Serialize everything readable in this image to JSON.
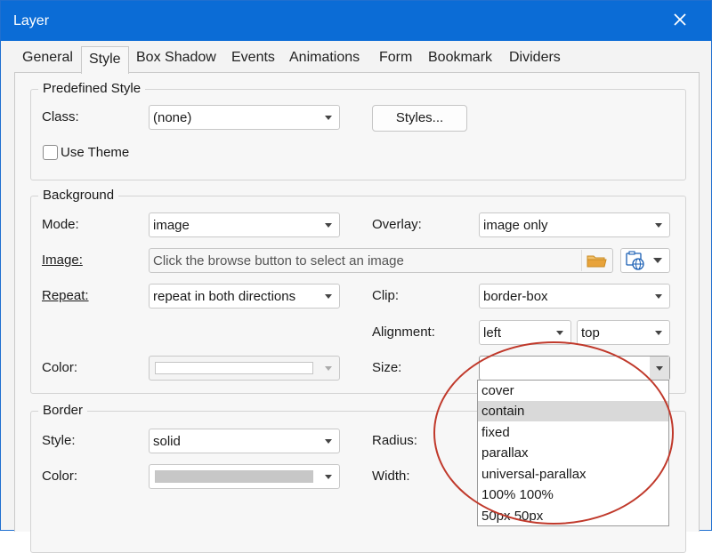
{
  "window": {
    "title": "Layer"
  },
  "tabs": [
    "General",
    "Style",
    "Box Shadow",
    "Events",
    "Animations",
    "Form",
    "Bookmark",
    "Dividers"
  ],
  "predefined": {
    "legend": "Predefined Style",
    "class_label": "Class:",
    "class_value": "(none)",
    "styles_button": "Styles...",
    "use_theme_label": "Use Theme"
  },
  "background": {
    "legend": "Background",
    "mode_label": "Mode:",
    "mode_value": "image",
    "overlay_label": "Overlay:",
    "overlay_value": "image only",
    "image_label": "Image:",
    "image_placeholder": "Click the browse button to select an image",
    "repeat_label": "Repeat:",
    "repeat_value": "repeat in both directions",
    "clip_label": "Clip:",
    "clip_value": "border-box",
    "alignment_label": "Alignment:",
    "alignment_h": "left",
    "alignment_v": "top",
    "color_label": "Color:",
    "size_label": "Size:",
    "size_value": "",
    "size_options": [
      "cover",
      "contain",
      "fixed",
      "parallax",
      "universal-parallax",
      "100% 100%",
      "50px 50px"
    ],
    "size_highlighted": "contain"
  },
  "border": {
    "legend": "Border",
    "style_label": "Style:",
    "style_value": "solid",
    "radius_label": "Radius:",
    "color_label": "Color:",
    "width_label": "Width:"
  },
  "colors": {
    "titlebar": "#0b6cd6",
    "annotation": "#c0392b",
    "folder": "#e8a33a"
  },
  "icons": [
    "close-icon",
    "folder-icon",
    "web-image-icon",
    "chevron-down-icon"
  ]
}
